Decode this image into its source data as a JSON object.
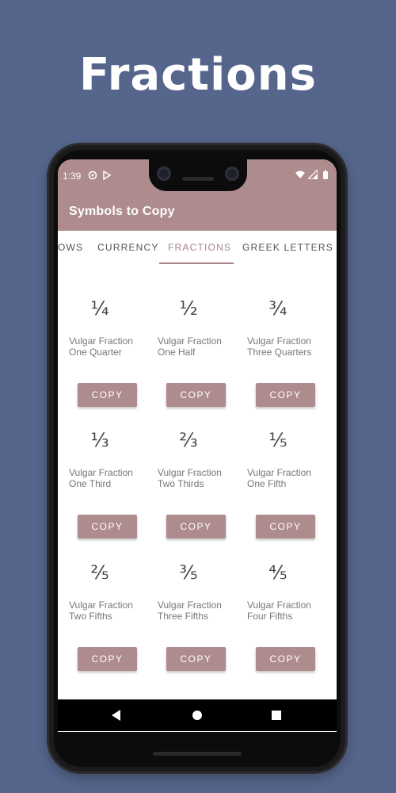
{
  "headline": "Fractions",
  "status": {
    "time": "1:39"
  },
  "app": {
    "title": "Symbols to Copy"
  },
  "tabs": [
    {
      "label": "OWS"
    },
    {
      "label": "CURRENCY"
    },
    {
      "label": "FRACTIONS",
      "active": true
    },
    {
      "label": "GREEK LETTERS"
    }
  ],
  "items": [
    {
      "symbol": "¼",
      "name": "Vulgar Fraction One Quarter",
      "button": "COPY"
    },
    {
      "symbol": "½",
      "name": "Vulgar Fraction One Half",
      "button": "COPY"
    },
    {
      "symbol": "¾",
      "name": "Vulgar Fraction Three Quarters",
      "button": "COPY"
    },
    {
      "symbol": "⅓",
      "name": "Vulgar Fraction One Third",
      "button": "COPY"
    },
    {
      "symbol": "⅔",
      "name": "Vulgar Fraction Two Thirds",
      "button": "COPY"
    },
    {
      "symbol": "⅕",
      "name": "Vulgar Fraction One Fifth",
      "button": "COPY"
    },
    {
      "symbol": "⅖",
      "name": "Vulgar Fraction Two Fifths",
      "button": "COPY"
    },
    {
      "symbol": "⅗",
      "name": "Vulgar Fraction Three Fifths",
      "button": "COPY"
    },
    {
      "symbol": "⅘",
      "name": "Vulgar Fraction Four Fifths",
      "button": "COPY"
    }
  ],
  "colors": {
    "background": "#56658c",
    "accent": "#ae8b8d",
    "tab_active": "#a98588"
  }
}
